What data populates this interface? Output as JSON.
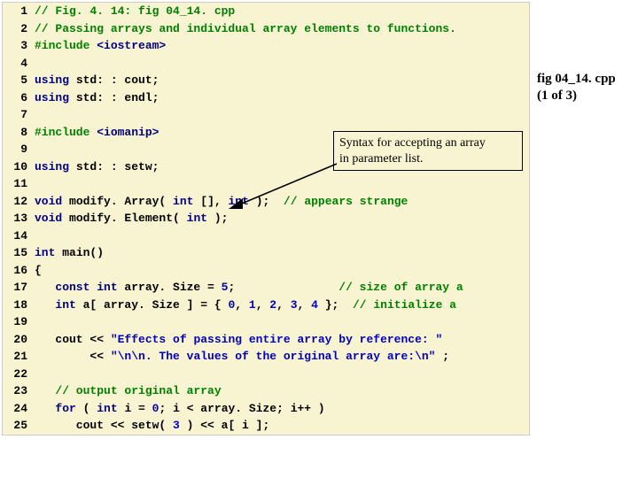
{
  "label": {
    "title": "fig 04_14. cpp",
    "page": "(1 of 3)"
  },
  "callout": {
    "text1": "Syntax for accepting an array",
    "text2": "in parameter list."
  },
  "lines": [
    {
      "n": "1",
      "segs": [
        {
          "c": "cmt",
          "t": "// Fig. 4. 14: fig 04_14. cpp"
        }
      ]
    },
    {
      "n": "2",
      "segs": [
        {
          "c": "cmt",
          "t": "// Passing arrays and individual array elements to functions."
        }
      ]
    },
    {
      "n": "3",
      "segs": [
        {
          "c": "pp",
          "t": "#include "
        },
        {
          "c": "kw",
          "t": "<iostream>"
        }
      ]
    },
    {
      "n": "4",
      "segs": []
    },
    {
      "n": "5",
      "segs": [
        {
          "c": "kw",
          "t": "using "
        },
        {
          "c": "plain",
          "t": "std: : cout;"
        }
      ]
    },
    {
      "n": "6",
      "segs": [
        {
          "c": "kw",
          "t": "using "
        },
        {
          "c": "plain",
          "t": "std: : endl;"
        }
      ]
    },
    {
      "n": "7",
      "segs": []
    },
    {
      "n": "8",
      "segs": [
        {
          "c": "pp",
          "t": "#include "
        },
        {
          "c": "kw",
          "t": "<iomanip>"
        }
      ]
    },
    {
      "n": "9",
      "segs": []
    },
    {
      "n": "10",
      "segs": [
        {
          "c": "kw",
          "t": "using "
        },
        {
          "c": "plain",
          "t": "std: : setw;"
        }
      ]
    },
    {
      "n": "11",
      "segs": []
    },
    {
      "n": "12",
      "segs": [
        {
          "c": "kw",
          "t": "void "
        },
        {
          "c": "plain",
          "t": "modify. Array( "
        },
        {
          "c": "kw",
          "t": "int "
        },
        {
          "c": "plain",
          "t": "[], "
        },
        {
          "c": "kw",
          "t": "int "
        },
        {
          "c": "plain",
          "t": ");  "
        },
        {
          "c": "cmt",
          "t": "// appears strange"
        }
      ]
    },
    {
      "n": "13",
      "segs": [
        {
          "c": "kw",
          "t": "void "
        },
        {
          "c": "plain",
          "t": "modify. Element( "
        },
        {
          "c": "kw",
          "t": "int "
        },
        {
          "c": "plain",
          "t": ");"
        }
      ]
    },
    {
      "n": "14",
      "segs": []
    },
    {
      "n": "15",
      "segs": [
        {
          "c": "kw",
          "t": "int "
        },
        {
          "c": "plain",
          "t": "main()"
        }
      ]
    },
    {
      "n": "16",
      "segs": [
        {
          "c": "plain",
          "t": "{"
        }
      ]
    },
    {
      "n": "17",
      "segs": [
        {
          "c": "plain",
          "t": "   "
        },
        {
          "c": "kw",
          "t": "const int "
        },
        {
          "c": "plain",
          "t": "array. Size = "
        },
        {
          "c": "num",
          "t": "5"
        },
        {
          "c": "plain",
          "t": ";               "
        },
        {
          "c": "cmt",
          "t": "// size of array a"
        }
      ]
    },
    {
      "n": "18",
      "segs": [
        {
          "c": "plain",
          "t": "   "
        },
        {
          "c": "kw",
          "t": "int "
        },
        {
          "c": "plain",
          "t": "a[ array. Size ] = { "
        },
        {
          "c": "num",
          "t": "0"
        },
        {
          "c": "plain",
          "t": ", "
        },
        {
          "c": "num",
          "t": "1"
        },
        {
          "c": "plain",
          "t": ", "
        },
        {
          "c": "num",
          "t": "2"
        },
        {
          "c": "plain",
          "t": ", "
        },
        {
          "c": "num",
          "t": "3"
        },
        {
          "c": "plain",
          "t": ", "
        },
        {
          "c": "num",
          "t": "4"
        },
        {
          "c": "plain",
          "t": " };  "
        },
        {
          "c": "cmt",
          "t": "// initialize a"
        }
      ]
    },
    {
      "n": "19",
      "segs": []
    },
    {
      "n": "20",
      "segs": [
        {
          "c": "plain",
          "t": "   cout << "
        },
        {
          "c": "str",
          "t": "\"Effects of passing entire array by reference: \""
        }
      ]
    },
    {
      "n": "21",
      "segs": [
        {
          "c": "plain",
          "t": "        << "
        },
        {
          "c": "str",
          "t": "\"\\n\\n. The values of the original array are:\\n\" "
        },
        {
          "c": "plain",
          "t": ";"
        }
      ]
    },
    {
      "n": "22",
      "segs": []
    },
    {
      "n": "23",
      "segs": [
        {
          "c": "plain",
          "t": "   "
        },
        {
          "c": "cmt",
          "t": "// output original array"
        }
      ]
    },
    {
      "n": "24",
      "segs": [
        {
          "c": "plain",
          "t": "   "
        },
        {
          "c": "kw",
          "t": "for "
        },
        {
          "c": "plain",
          "t": "( "
        },
        {
          "c": "kw",
          "t": "int "
        },
        {
          "c": "plain",
          "t": "i = "
        },
        {
          "c": "num",
          "t": "0"
        },
        {
          "c": "plain",
          "t": "; i < array. Size; i++ )"
        }
      ]
    },
    {
      "n": "25",
      "segs": [
        {
          "c": "plain",
          "t": "      cout << setw( "
        },
        {
          "c": "num",
          "t": "3"
        },
        {
          "c": "plain",
          "t": " ) << a[ i ];"
        }
      ]
    }
  ]
}
